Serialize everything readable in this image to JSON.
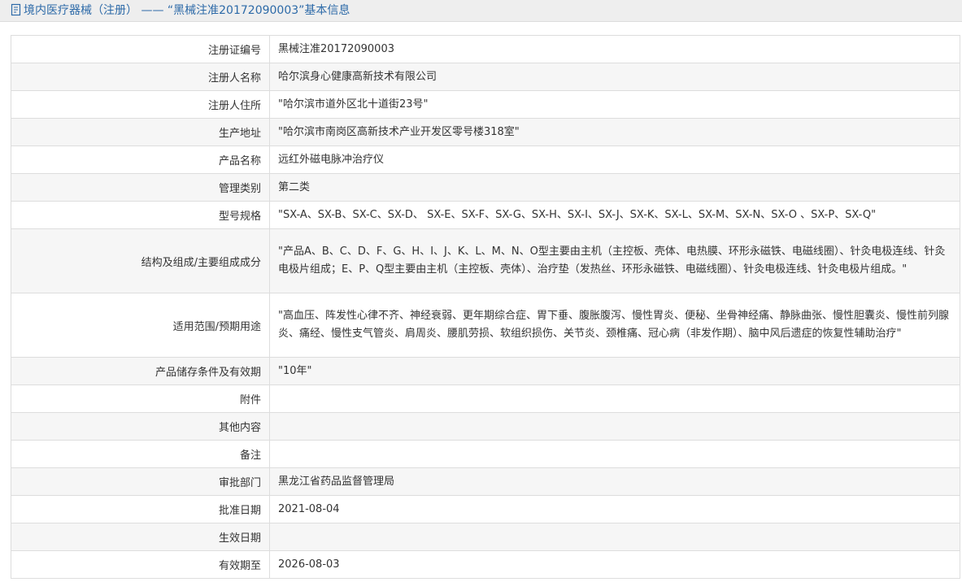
{
  "page": {
    "title": "境内医疗器械（注册） —— “黑械注准20172090003”基本信息",
    "colors": {
      "title": "#2d6aa8",
      "title_bar_bg": "#eeeeee",
      "row_alt_bg": "#f6f6f6",
      "border": "#dddddd"
    }
  },
  "fields": [
    {
      "label": "注册证编号",
      "value": "黑械注准20172090003"
    },
    {
      "label": "注册人名称",
      "value": "哈尔滨身心健康高新技术有限公司"
    },
    {
      "label": "注册人住所",
      "value": "\"哈尔滨市道外区北十道街23号\""
    },
    {
      "label": "生产地址",
      "value": "\"哈尔滨市南岗区高新技术产业开发区零号楼318室\""
    },
    {
      "label": "产品名称",
      "value": "远红外磁电脉冲治疗仪"
    },
    {
      "label": "管理类别",
      "value": "第二类"
    },
    {
      "label": "型号规格",
      "value": "\"SX-A、SX-B、SX-C、SX-D、 SX-E、SX-F、SX-G、SX-H、SX-I、SX-J、SX-K、SX-L、SX-M、SX-N、SX-O 、SX-P、SX-Q\""
    },
    {
      "label": "结构及组成/主要组成成分",
      "value": "\"产品A、B、C、D、F、G、H、I、J、K、L、M、N、O型主要由主机（主控板、壳体、电热膜、环形永磁铁、电磁线圈）、针灸电极连线、针灸电极片组成；E、P、Q型主要由主机（主控板、壳体）、治疗垫（发热丝、环形永磁铁、电磁线圈）、针灸电极连线、针灸电极片组成。\""
    },
    {
      "label": "适用范围/预期用途",
      "value": "\"高血压、阵发性心律不齐、神经衰弱、更年期综合症、胃下垂、腹胀腹泻、慢性胃炎、便秘、坐骨神经痛、静脉曲张、慢性胆囊炎、慢性前列腺炎、痛经、慢性支气管炎、肩周炎、腰肌劳损、软组织损伤、关节炎、颈椎痛、冠心病（非发作期）、脑中风后遗症的恢复性辅助治疗\""
    },
    {
      "label": "产品储存条件及有效期",
      "value": "\"10年\""
    },
    {
      "label": "附件",
      "value": ""
    },
    {
      "label": "其他内容",
      "value": ""
    },
    {
      "label": "备注",
      "value": ""
    },
    {
      "label": "审批部门",
      "value": "黑龙江省药品监督管理局"
    },
    {
      "label": "批准日期",
      "value": "2021-08-04"
    },
    {
      "label": "生效日期",
      "value": ""
    },
    {
      "label": "有效期至",
      "value": "2026-08-03"
    }
  ]
}
